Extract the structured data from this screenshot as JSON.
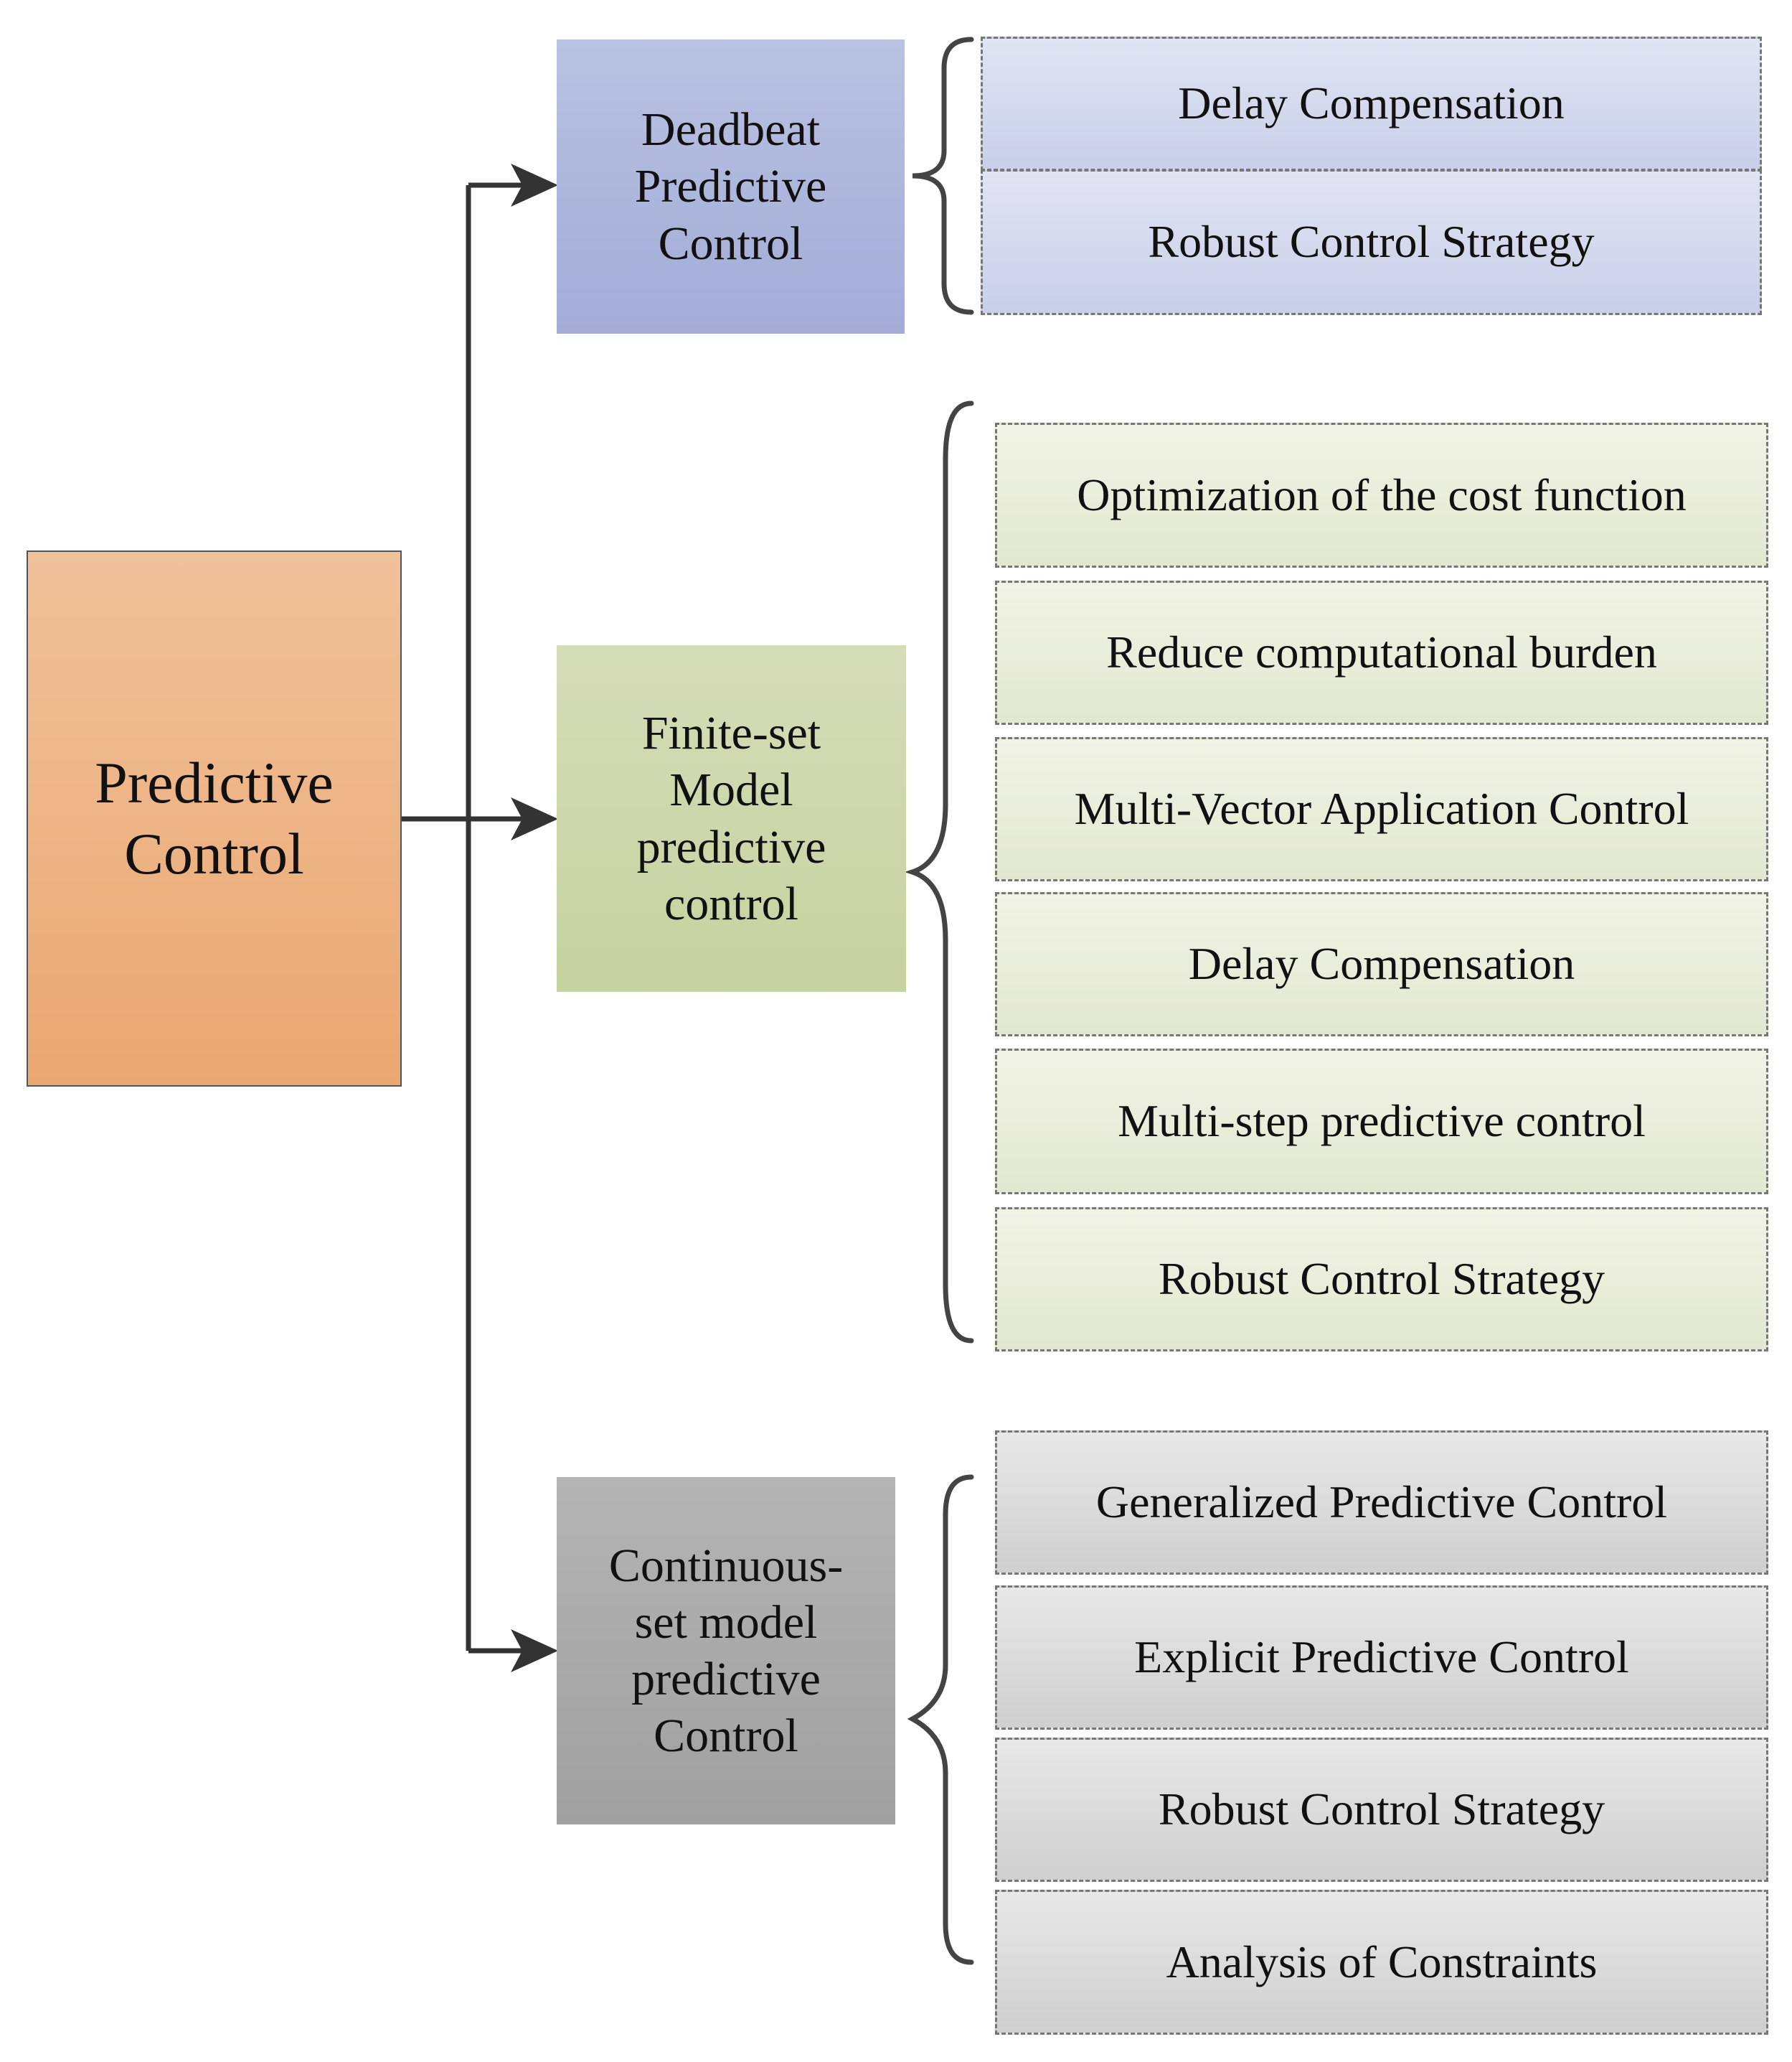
{
  "root": {
    "label": "Predictive Control",
    "color": "#eeb383"
  },
  "branches": [
    {
      "label": "Deadbeat Predictive Control",
      "color": "#aeb7dd",
      "items": [
        "Delay Compensation",
        "Robust Control Strategy"
      ]
    },
    {
      "label": "Finite-set Model predictive control",
      "color": "#ccd7ab",
      "items": [
        "Optimization of the cost function",
        "Reduce computational burden",
        "Multi-Vector Application Control",
        "Delay Compensation",
        "Multi-step predictive control",
        "Robust Control Strategy"
      ]
    },
    {
      "label": "Continuous-set model predictive Control",
      "color": "#aaaaaa",
      "items": [
        "Generalized Predictive Control",
        "Explicit Predictive Control",
        "Robust Control Strategy",
        "Analysis of Constraints"
      ]
    }
  ]
}
